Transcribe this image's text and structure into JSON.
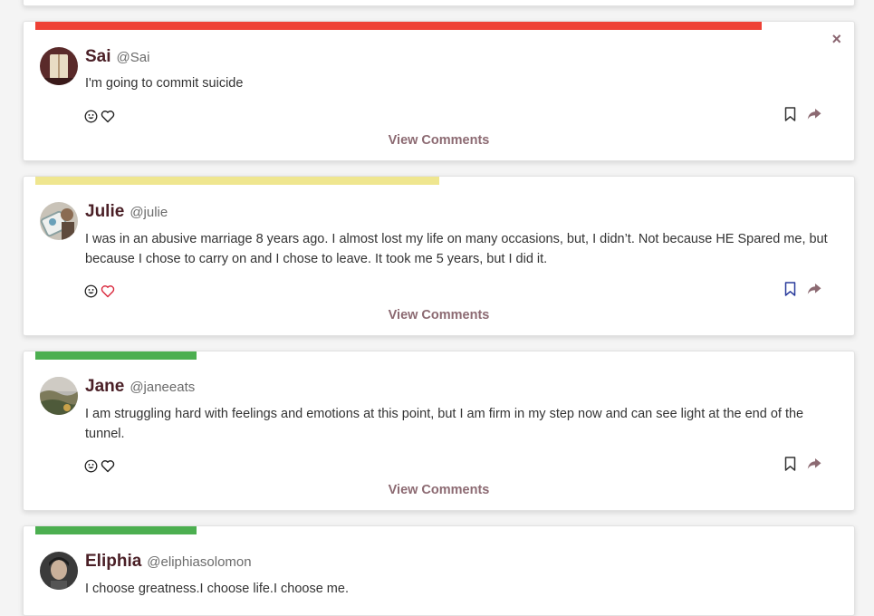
{
  "posts": [
    {
      "name": "Sai",
      "handle": "@Sai",
      "text": "I'm going to commit suicide",
      "bar_color": "#ee4135",
      "bar_fill": 0.89,
      "liked": false,
      "bookmarked": false,
      "close_label": "×",
      "view_comments": "View Comments"
    },
    {
      "name": "Julie",
      "handle": "@julie",
      "text": "I was in an abusive marriage 8 years ago. I almost lost my life on many occasions, but, I didn’t. Not because HE Spared me, but because I chose to carry on and I chose to leave. It took me 5 years, but I did it.",
      "bar_color": "#efe68f",
      "bar_fill": 0.49,
      "liked": true,
      "bookmarked": true,
      "view_comments": "View Comments"
    },
    {
      "name": "Jane",
      "handle": "@janeeats",
      "text": "I am struggling hard with feelings and emotions at this point, but I am firm in my step now and can see light at the end of the tunnel.",
      "bar_color": "#4caf50",
      "bar_fill": 0.19,
      "liked": false,
      "bookmarked": false,
      "view_comments": "View Comments"
    },
    {
      "name": "Eliphia",
      "handle": "@eliphiasolomon",
      "text": "I choose greatness.I choose life.I choose me.",
      "bar_color": "#4caf50",
      "bar_fill": 0.19
    }
  ],
  "colors": {
    "accent": "#8c6a72",
    "name": "#4a1f26",
    "liked_heart": "#d9283c",
    "bookmarked": "#2a3b9c"
  },
  "icons": [
    "smiley-icon",
    "heart-icon",
    "bookmark-icon",
    "share-icon",
    "close-icon"
  ]
}
